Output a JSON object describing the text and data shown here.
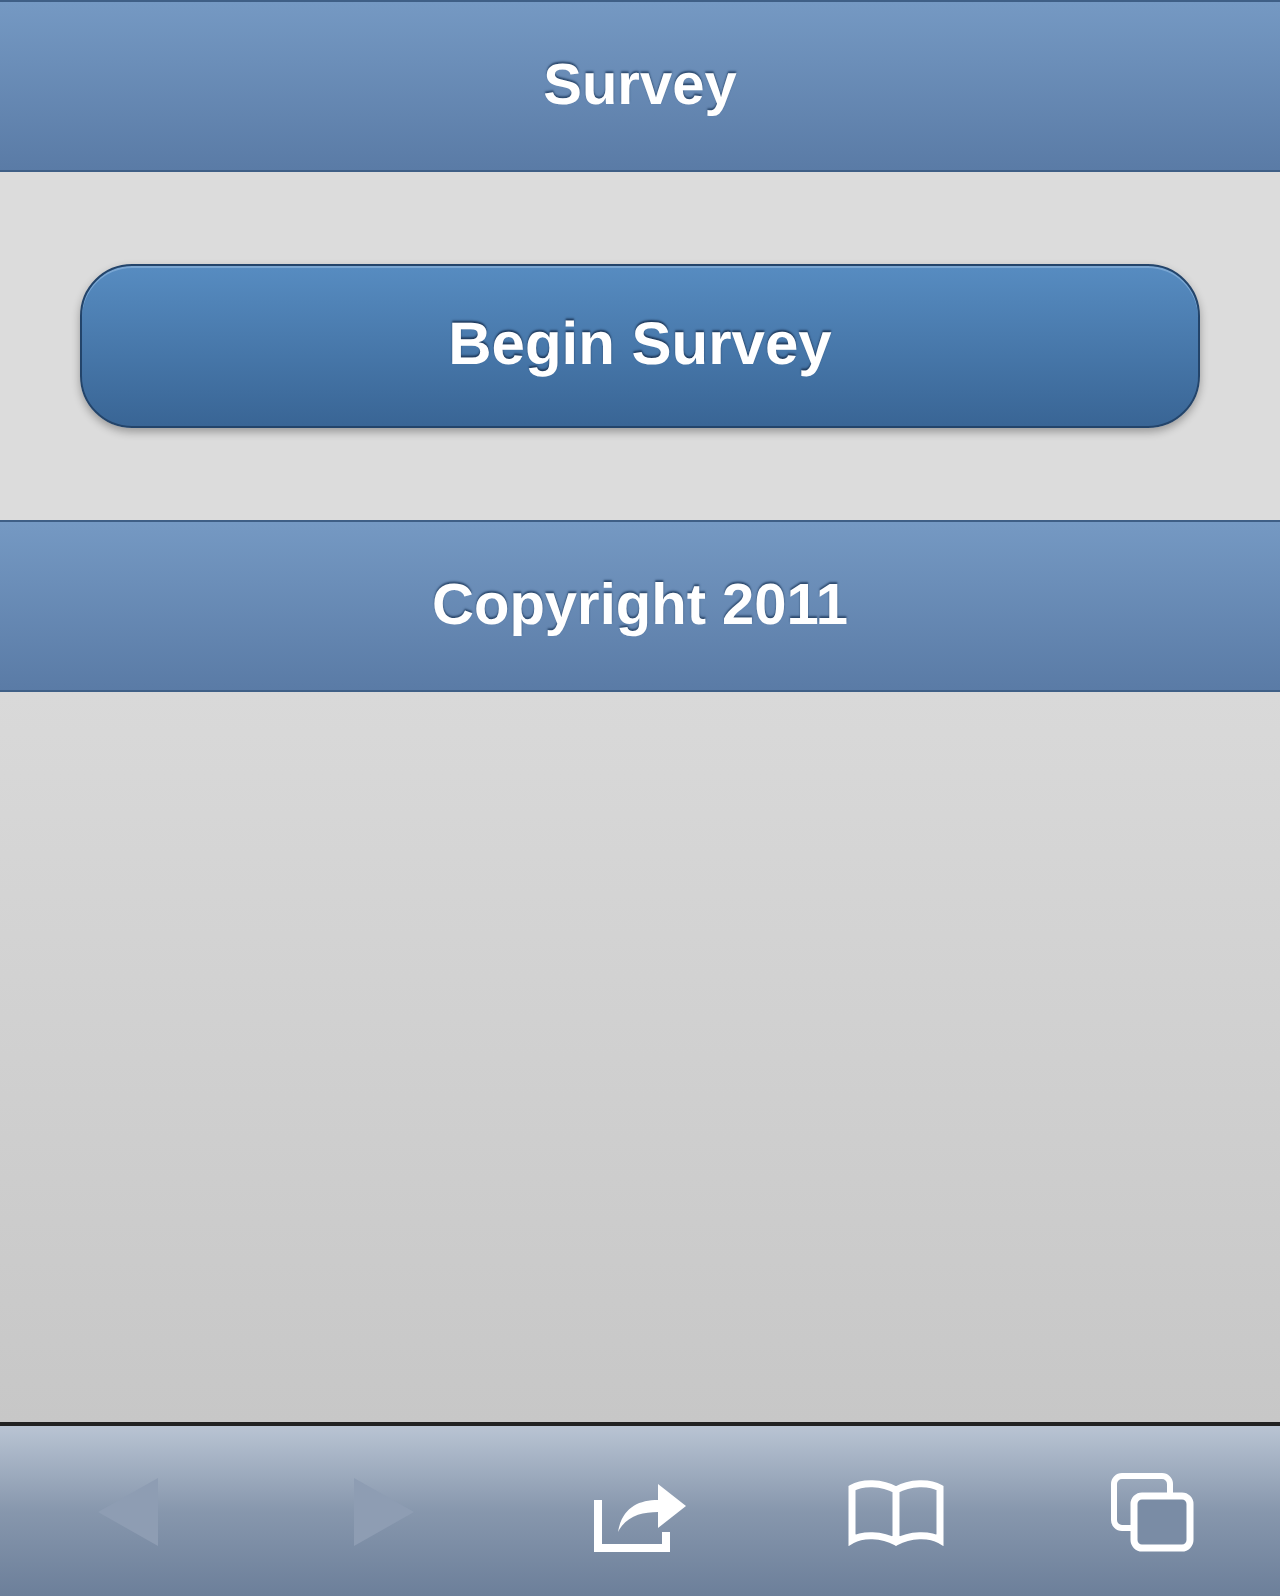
{
  "header": {
    "title": "Survey"
  },
  "content": {
    "button": "Begin Survey"
  },
  "footer": {
    "text": "Copyright 2011"
  },
  "toolbar": [
    {
      "kind": "back",
      "disabled": true
    },
    {
      "kind": "forward",
      "disabled": true
    },
    {
      "kind": "share",
      "disabled": false
    },
    {
      "kind": "bookmarks",
      "disabled": false
    },
    {
      "kind": "tabs",
      "disabled": false
    }
  ]
}
